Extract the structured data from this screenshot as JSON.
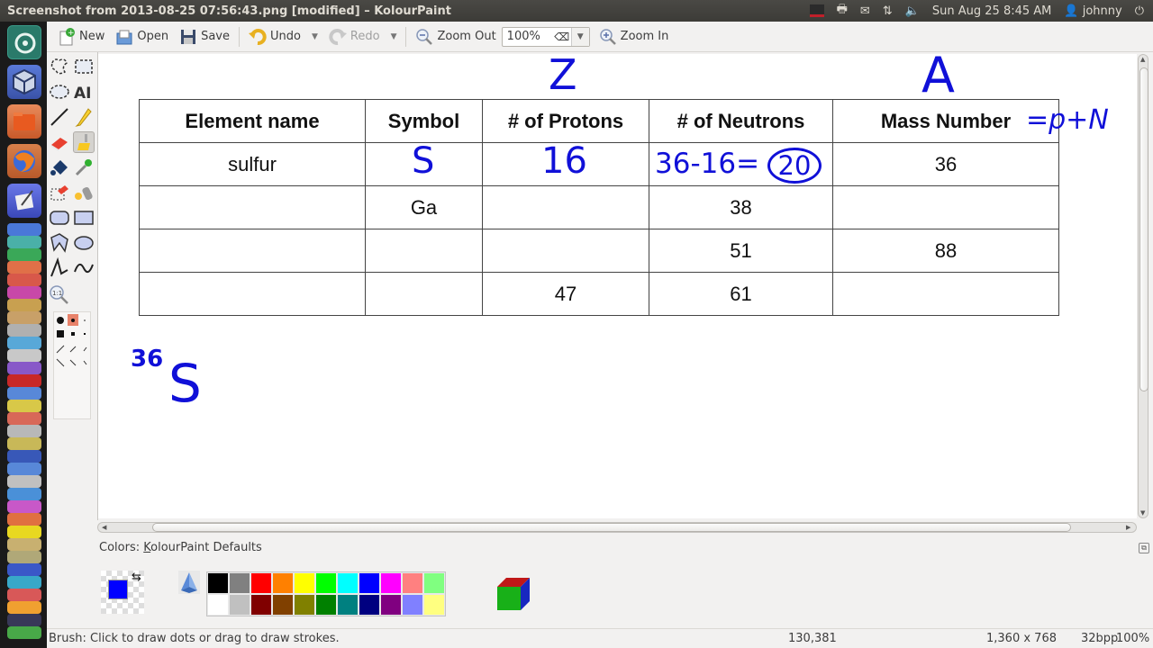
{
  "window": {
    "title": "Screenshot from 2013-08-25 07:56:43.png [modified] – KolourPaint"
  },
  "panel": {
    "datetime": "Sun Aug 25  8:45 AM",
    "user": "johnny",
    "icons": [
      "screen-recorder-icon",
      "printer-icon",
      "mail-icon",
      "network-icon",
      "volume-icon",
      "power-icon"
    ]
  },
  "toolbar": {
    "new_label": "New",
    "open_label": "Open",
    "save_label": "Save",
    "undo_label": "Undo",
    "redo_label": "Redo",
    "zoom_out_label": "Zoom Out",
    "zoom_value": "100%",
    "zoom_in_label": "Zoom In"
  },
  "tools": [
    "free-form-selection",
    "rectangular-selection",
    "elliptical-selection",
    "text",
    "line",
    "pen",
    "eraser",
    "brush",
    "flood-fill",
    "color-picker",
    "color-eraser",
    "spraycan",
    "rounded-rectangle",
    "rectangle",
    "polygon",
    "ellipse",
    "connected-lines",
    "curve",
    "zoom"
  ],
  "selected_tool": "brush",
  "canvas": {
    "table": {
      "headers": [
        "Element name",
        "Symbol",
        "# of Protons",
        "# of Neutrons",
        "Mass Number"
      ],
      "rows": [
        [
          "sulfur",
          "",
          "",
          "",
          "36"
        ],
        [
          "",
          "Ga",
          "",
          "38",
          ""
        ],
        [
          "",
          "",
          "",
          "51",
          "88"
        ],
        [
          "",
          "",
          "47",
          "61",
          ""
        ]
      ]
    },
    "annotations": {
      "protons_header_label": "Z",
      "mass_header_label": "A",
      "mass_formula": "=p+N",
      "sulfur_symbol": "S",
      "sulfur_protons": "16",
      "sulfur_neutrons_calc": "36-16=",
      "sulfur_neutrons_result": "20",
      "isotope_mass": "36",
      "isotope_symbol": "S"
    },
    "ink_color": "#1010d8"
  },
  "colors": {
    "label_prefix": "Colors: ",
    "label_accel": "K",
    "label_rest": "olourPaint Defaults",
    "foreground": "#0000ff",
    "palette_top": [
      "#000000",
      "#808080",
      "#ff0000",
      "#ff8000",
      "#ffff00",
      "#00ff00",
      "#00ffff",
      "#0000ff",
      "#ff00ff",
      "#ff8080",
      "#80ff80"
    ],
    "palette_bottom": [
      "#ffffff",
      "#c0c0c0",
      "#800000",
      "#804000",
      "#808000",
      "#008000",
      "#008080",
      "#000080",
      "#800080",
      "#8080ff",
      "#ffff80"
    ]
  },
  "status": {
    "message": "Brush: Click to draw dots or drag to draw strokes.",
    "cursor": "130,381",
    "dimensions": "1,360 x 768",
    "depth": "32bpp",
    "zoom": "100%"
  }
}
